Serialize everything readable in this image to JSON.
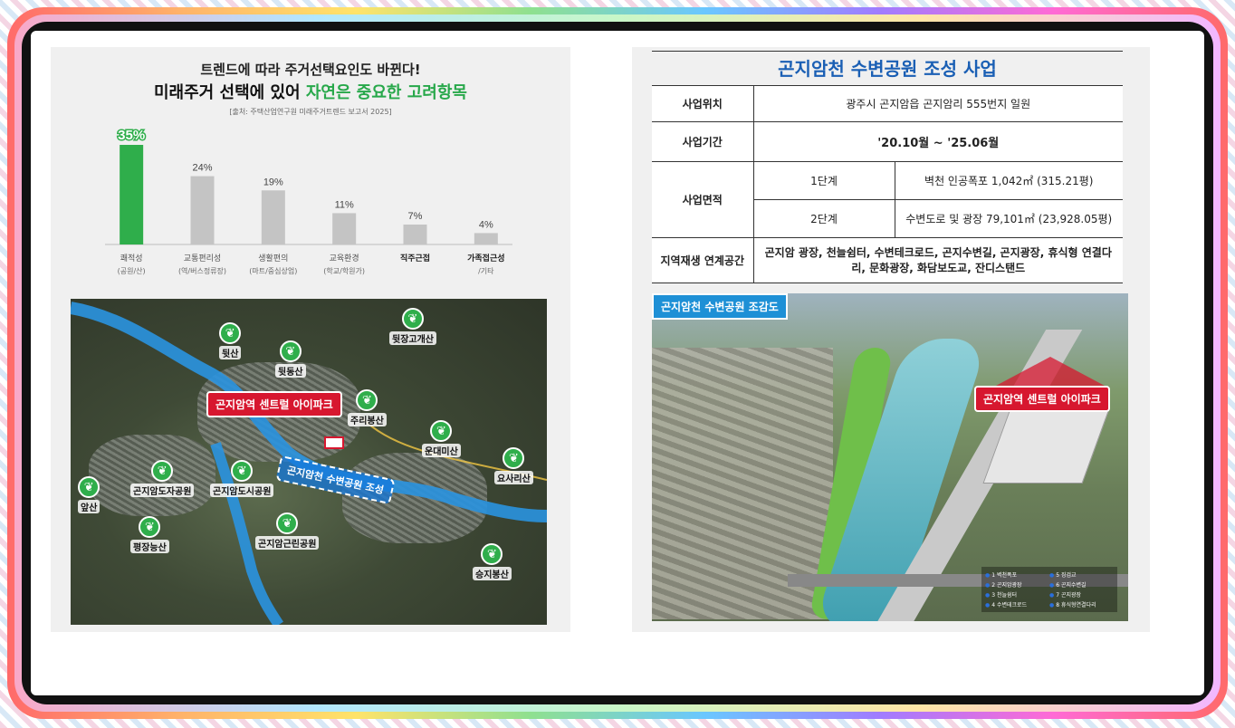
{
  "left": {
    "title_line1": "트렌드에 따라 주거선택요인도 바뀐다!",
    "title_line2_prefix": "미래주거 선택에 있어 ",
    "title_line2_highlight": "자연은 중요한 고려항목",
    "source": "[출처: 주택산업연구원 미래주거트렌드 보고서 2025]",
    "map": {
      "project_label": "곤지암역 센트럴 아이파크",
      "park_label": "곤지암천 수변공원 조성",
      "pins": [
        {
          "label": "뒷산"
        },
        {
          "label": "뒷동산"
        },
        {
          "label": "뒷장고개산"
        },
        {
          "label": "주리봉산"
        },
        {
          "label": "운대미산"
        },
        {
          "label": "요사리산"
        },
        {
          "label": "곤지암도자공원"
        },
        {
          "label": "곤지암도시공원"
        },
        {
          "label": "앞산"
        },
        {
          "label": "평장능산"
        },
        {
          "label": "곤지암근린공원"
        },
        {
          "label": "승지봉산"
        }
      ]
    }
  },
  "chart_data": {
    "type": "bar",
    "categories": [
      "쾌적성 (공원/산)",
      "교통편리성 (역/버스정류장)",
      "생활편의 (마트/중심상업)",
      "교육환경 (학교/학원가)",
      "직주근접",
      "가족접근성 /기타"
    ],
    "category_line1": [
      "쾌적성",
      "교통편리성",
      "생활편의",
      "교육환경",
      "직주근접",
      "가족접근성"
    ],
    "category_line2": [
      "(공원/산)",
      "(역/버스정류장)",
      "(마트/중심상업)",
      "(학교/학원가)",
      "",
      "/기타"
    ],
    "values": [
      35,
      24,
      19,
      11,
      7,
      4
    ],
    "value_labels": [
      "35%",
      "24%",
      "19%",
      "11%",
      "7%",
      "4%"
    ],
    "highlight_color": "#2fae4b",
    "bar_color": "#c4c4c4"
  },
  "right": {
    "title": "곤지암천 수변공원 조성 사업",
    "rows": {
      "location_head": "사업위치",
      "location": "광주시 곤지암읍 곤지암리 555번지 일원",
      "period_head": "사업기간",
      "period": "'20.10월 ~ '25.06월",
      "area_head": "사업면적",
      "stage1": "1단계",
      "stage1_value": "벽천 인공폭포 1,042㎡ (315.21평)",
      "stage2": "2단계",
      "stage2_value": "수변도로 및 광장 79,101㎡ (23,928.05평)",
      "regen_head": "지역재생 연계공간",
      "regen_value": "곤지암 광장, 천늘쉼터, 수변테크로드, 곤지수변길, 곤지광장, 휴식형 연결다리, 문화광장, 화담보도교, 잔디스탠드"
    },
    "photo": {
      "label": "곤지암천 수변공원 조감도",
      "project_label": "곤지암역 센트럴 아이파크",
      "legend": [
        "1 벽천폭포",
        "5 징검교",
        "2 곤지암광장",
        "6 곤지수변길",
        "3 천늘쉼터",
        "7 곤지광장",
        "4 수변테크로드",
        "8 휴식형연결다리"
      ]
    }
  }
}
